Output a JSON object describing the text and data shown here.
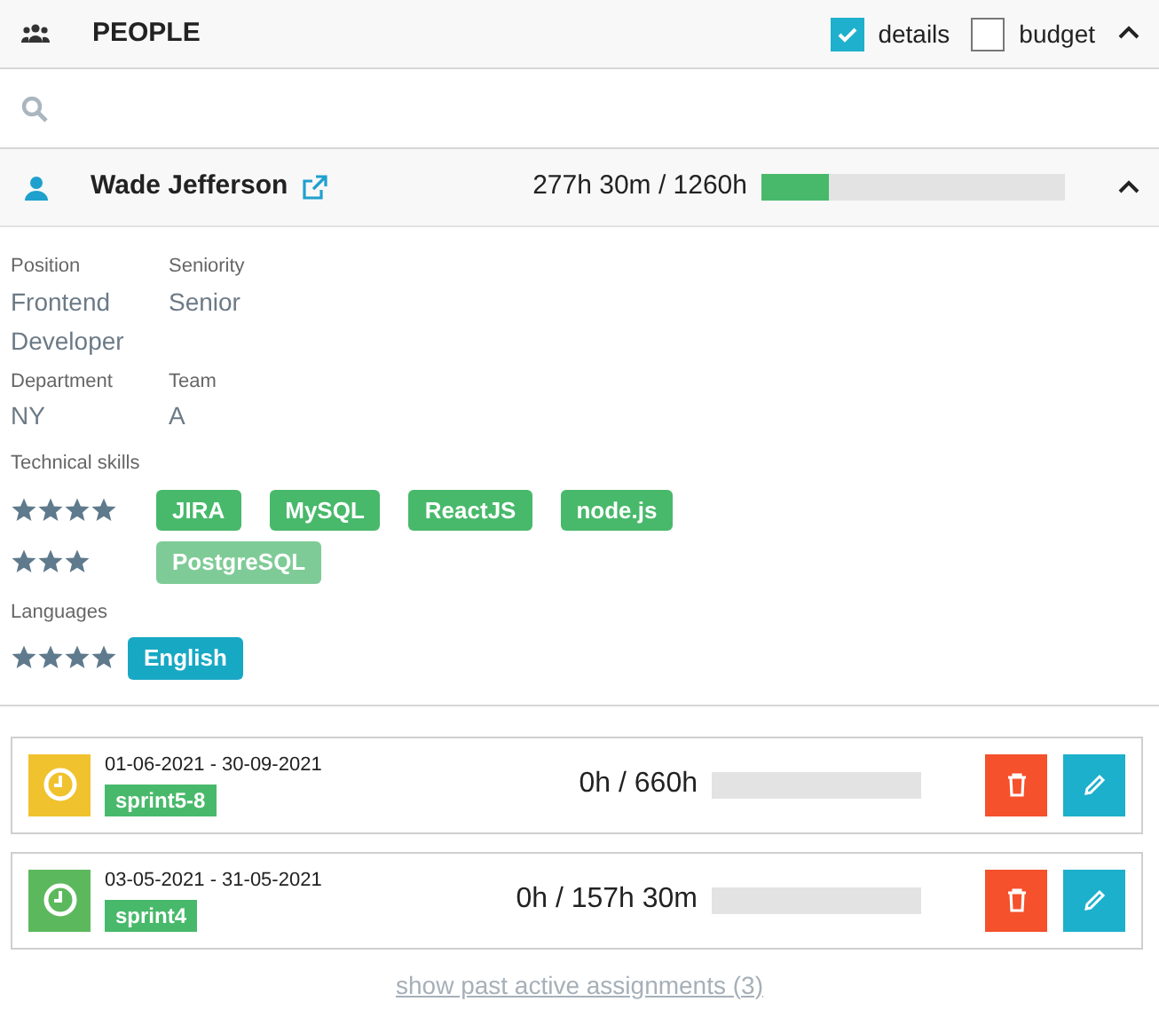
{
  "header": {
    "title": "PEOPLE",
    "toggles": [
      {
        "label": "details",
        "checked": true
      },
      {
        "label": "budget",
        "checked": false
      }
    ],
    "expanded": true
  },
  "person": {
    "name": "Wade Jefferson",
    "hours": "277h 30m / 1260h",
    "level": 0.22,
    "expanded": true,
    "fields": [
      {
        "label": "Position",
        "value": "Frontend Developer"
      },
      {
        "label": "Seniority",
        "value": "Senior"
      },
      {
        "label": "Department",
        "value": "NY"
      },
      {
        "label": "Team",
        "value": "A"
      }
    ],
    "skills_label": "Technical skills",
    "skills": [
      {
        "stars": 4,
        "tags": [
          {
            "label": "JIRA",
            "color": "#48b96b"
          },
          {
            "label": "MySQL",
            "color": "#48b96b"
          },
          {
            "label": "ReactJS",
            "color": "#48b96b"
          },
          {
            "label": "node.js",
            "color": "#48b96b"
          }
        ]
      },
      {
        "stars": 3,
        "tags": [
          {
            "label": "PostgreSQL",
            "color": "#7fcb97"
          }
        ]
      }
    ],
    "languages_label": "Languages",
    "languages": [
      {
        "stars": 4,
        "tags": [
          {
            "label": "English",
            "color": "#17a8c4"
          }
        ]
      }
    ]
  },
  "assignments": [
    {
      "dates": "01-06-2021 - 30-09-2021",
      "tag": "sprint5-8",
      "hours": "0h / 660h",
      "level": 0,
      "color": "#f0c22e"
    },
    {
      "dates": "03-05-2021 - 31-05-2021",
      "tag": "sprint4",
      "hours": "0h / 157h 30m",
      "level": 0,
      "color": "#5cb85c"
    }
  ],
  "footer_link": "show past active assignments (3)"
}
